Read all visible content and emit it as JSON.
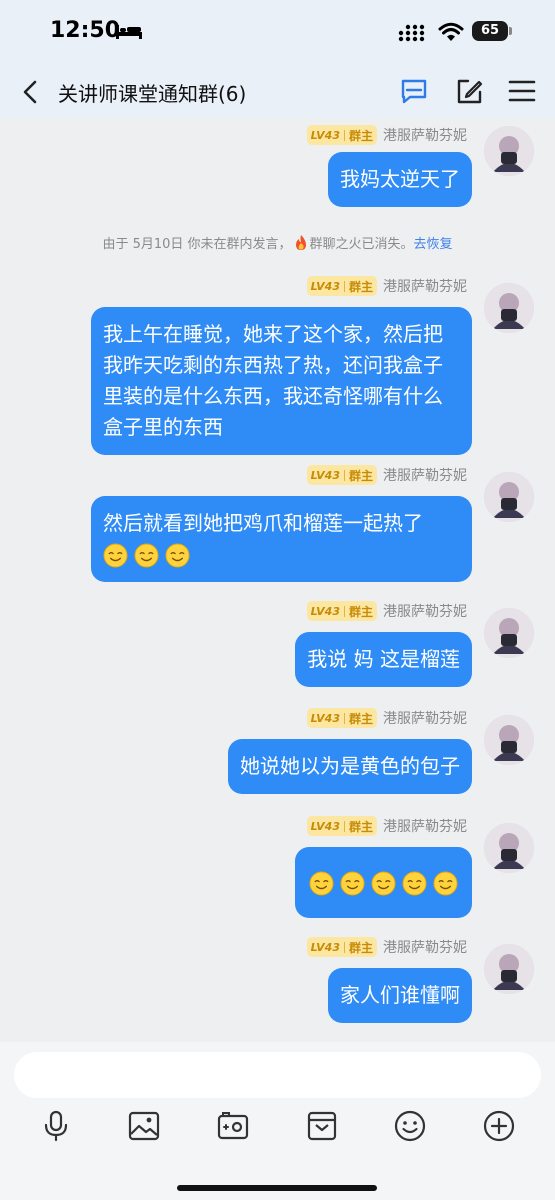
{
  "status_bar": {
    "time": "12:50",
    "battery": "65"
  },
  "header": {
    "title": "关讲师课堂通知群(6)"
  },
  "sender": {
    "level": "LV43",
    "role": "群主",
    "name": "港服萨勒芬妮"
  },
  "system_note": {
    "prefix": "由于 5月10日 你未在群内发言，",
    "suffix": "群聊之火已消失。",
    "link": "去恢复"
  },
  "messages": [
    {
      "text": "我妈太逆天了"
    },
    {
      "text": "我上午在睡觉，她来了这个家，然后把我昨天吃剩的东西热了热，还问我盒子里装的是什么东西，我还奇怪哪有什么盒子里的东西"
    },
    {
      "text": "然后就看到她把鸡爪和榴莲一起热了",
      "emojis": [
        "smile-emoji",
        "smile-emoji",
        "smile-emoji"
      ]
    },
    {
      "text": "我说 妈 这是榴莲"
    },
    {
      "text": "她说她以为是黄色的包子"
    },
    {
      "text": "",
      "emojis": [
        "smile-emoji",
        "smile-emoji",
        "smile-emoji",
        "smile-emoji",
        "smile-emoji"
      ]
    },
    {
      "text": "家人们谁懂啊"
    }
  ],
  "input": {
    "placeholder": ""
  },
  "toolbar": {
    "icons": [
      "mic-icon",
      "image-icon",
      "camera-icon",
      "envelope-icon",
      "emoji-icon",
      "plus-icon"
    ]
  },
  "colors": {
    "bubble": "#2f8cf6",
    "badge_bg": "#fbe7a1",
    "badge_text": "#c98a06",
    "link": "#3b82e8",
    "header_bg": "#e9f0f8",
    "chat_bg": "#eeeff1"
  }
}
